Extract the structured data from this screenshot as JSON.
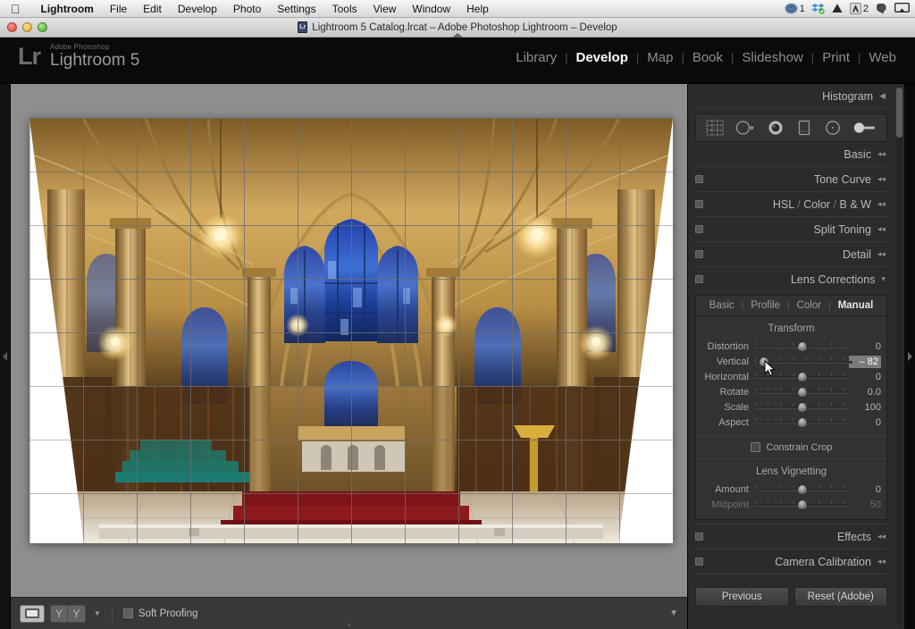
{
  "menubar": {
    "apple": "apple-logo",
    "items": [
      {
        "label": "Lightroom",
        "bold": true
      },
      {
        "label": "File",
        "bold": false
      },
      {
        "label": "Edit",
        "bold": false
      },
      {
        "label": "Develop",
        "bold": false
      },
      {
        "label": "Photo",
        "bold": false
      },
      {
        "label": "Settings",
        "bold": false
      },
      {
        "label": "Tools",
        "bold": false
      },
      {
        "label": "View",
        "bold": false
      },
      {
        "label": "Window",
        "bold": false
      },
      {
        "label": "Help",
        "bold": false
      }
    ],
    "tray": {
      "creative_cloud_badge": "1",
      "adobe_badge": "2"
    }
  },
  "window": {
    "title": "Lightroom 5 Catalog.lrcat – Adobe Photoshop Lightroom – Develop"
  },
  "identity": {
    "mark": "Lr",
    "brand_small": "Adobe Photoshop",
    "brand_large": "Lightroom 5"
  },
  "modules": [
    {
      "label": "Library",
      "active": false
    },
    {
      "label": "Develop",
      "active": true
    },
    {
      "label": "Map",
      "active": false
    },
    {
      "label": "Book",
      "active": false
    },
    {
      "label": "Slideshow",
      "active": false
    },
    {
      "label": "Print",
      "active": false
    },
    {
      "label": "Web",
      "active": false
    }
  ],
  "panels": {
    "histogram": {
      "title": "Histogram"
    },
    "basic": {
      "title": "Basic"
    },
    "tone_curve": {
      "title": "Tone Curve"
    },
    "hsl": {
      "title_a": "HSL",
      "title_b": "Color",
      "title_c": "B & W",
      "sep": "/"
    },
    "split_toning": {
      "title": "Split Toning"
    },
    "detail": {
      "title": "Detail"
    },
    "lens_corrections": {
      "title": "Lens Corrections"
    },
    "effects": {
      "title": "Effects"
    },
    "camera_calibration": {
      "title": "Camera Calibration"
    }
  },
  "toolstrip": [
    {
      "name": "crop-overlay-tool",
      "selected": false
    },
    {
      "name": "spot-removal-tool",
      "selected": false
    },
    {
      "name": "red-eye-correction-tool",
      "selected": true
    },
    {
      "name": "graduated-filter-tool",
      "selected": false
    },
    {
      "name": "radial-filter-tool",
      "selected": false
    },
    {
      "name": "adjustment-brush-tool",
      "selected": false
    }
  ],
  "lens_corrections": {
    "tabs": [
      {
        "label": "Basic",
        "active": false
      },
      {
        "label": "Profile",
        "active": false
      },
      {
        "label": "Color",
        "active": false
      },
      {
        "label": "Manual",
        "active": true
      }
    ],
    "tab_sep": "|",
    "transform_title": "Transform",
    "transform_sliders": [
      {
        "label": "Distortion",
        "value": "0",
        "pos": 50,
        "highlight": false,
        "dim": false
      },
      {
        "label": "Vertical",
        "value": "– 82",
        "pos": 9,
        "highlight": true,
        "dim": false
      },
      {
        "label": "Horizontal",
        "value": "0",
        "pos": 50,
        "highlight": false,
        "dim": false
      },
      {
        "label": "Rotate",
        "value": "0.0",
        "pos": 50,
        "highlight": false,
        "dim": false
      },
      {
        "label": "Scale",
        "value": "100",
        "pos": 50,
        "highlight": false,
        "dim": false
      },
      {
        "label": "Aspect",
        "value": "0",
        "pos": 50,
        "highlight": false,
        "dim": false
      }
    ],
    "constrain_crop": {
      "label": "Constrain Crop",
      "checked": false
    },
    "vignetting_title": "Lens Vignetting",
    "vignetting_sliders": [
      {
        "label": "Amount",
        "value": "0",
        "pos": 50,
        "highlight": false,
        "dim": false
      },
      {
        "label": "Midpoint",
        "value": "50",
        "pos": 50,
        "highlight": false,
        "dim": true
      }
    ]
  },
  "footer_buttons": {
    "previous": "Previous",
    "reset": "Reset (Adobe)"
  },
  "toolbar": {
    "loupe_view": "loupe-view-icon",
    "compare_y1": "Y",
    "compare_y2": "Y",
    "soft_proofing_label": "Soft Proofing",
    "soft_proofing_checked": false
  },
  "colors": {
    "panel_bg": "#2b2b2b",
    "canvas_bg": "#8e8e8e",
    "accent_text": "#b9b9b9",
    "active_text": "#ffffff",
    "highlight_field": "#7c7c7c"
  }
}
